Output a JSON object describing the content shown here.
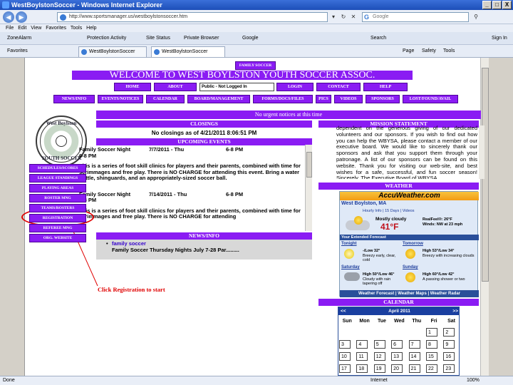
{
  "window": {
    "title": "WestBoylstonSoccer - Windows Internet Explorer",
    "min": "_",
    "max": "□",
    "close": "X"
  },
  "address": {
    "url": "http://www.sportsmanager.us/westboylstonsoccer.htm",
    "search_placeholder": "Google"
  },
  "menu": {
    "items": [
      "File",
      "Edit",
      "View",
      "Favorites",
      "Tools",
      "Help"
    ]
  },
  "toolbar": {
    "zone": "ZoneAlarm",
    "protection": "Protection Activity",
    "site_status": "Site Status",
    "private": "Private Browser",
    "google": "Google",
    "search": "Search",
    "signin": "Sign In"
  },
  "favbar": {
    "favorites": "Favorites",
    "tab1": "WestBoylstonSoccer",
    "tab2": "WestBoylstonSoccer",
    "page": "Page",
    "safety": "Safety",
    "tools": "Tools"
  },
  "site": {
    "family_soccer": "FAMILY SOCCER",
    "welcome": "WELCOME TO WEST BOYLSTON YOUTH SOCCER ASSOC.",
    "nav1": [
      "HOME",
      "ABOUT",
      "LOGIN",
      "CONTACT",
      "HELP"
    ],
    "login_status": "Public - Not Logged In",
    "nav2": [
      "NEWS/INFO",
      "EVENTS/NOTICES",
      "CALENDAR",
      "BOARD/MANAGEMENT",
      "FORMS/DOCS/FILES",
      "PICS",
      "VIDEOS",
      "SPONSORS",
      "LOST/FOUND/AVAIL"
    ],
    "logo_top": "West Boylston",
    "logo_bottom": "YOUTH SOCCER",
    "side": [
      "SCHEDULES/SCORES",
      "LEAGUE STANDINGS",
      "PLAYING AREAS",
      "ROSTER MNG",
      "TEAMS/ROSTERS",
      "REGISTRATION",
      "REFEREE MNG",
      "ORG. WEBSITE"
    ],
    "notice": "No urgent notices at this time",
    "closings_head": "CLOSINGS",
    "closings_text": "No closings as of 4/21/2011 8:06:51 PM",
    "upcoming_head": "UPCOMING EVENTS",
    "events": [
      {
        "title": "Family Soccer Night 6-8 PM",
        "date": "7/7/2011 - Thu",
        "time": "6-8 PM",
        "body": "This is a series of foot skill clinics for players and their parents, combined with time for scrimmages and free play. There is NO CHARGE for attending this event. Bring a water bottle, shinguards, and an appropriately-sized soccer ball."
      },
      {
        "title": "Family Soccer Night 6-8 PM",
        "date": "7/14/2011 - Thu",
        "time": "6-8 PM",
        "body": "This is a series of foot skill clinics for players and their parents, combined with time for scrimmages and free play. There is NO CHARGE for attending"
      }
    ],
    "news_head": "NEWS/INFO",
    "news_link": "family soccer",
    "news_sub": "Family Soccer Thursday Nights July 7-28 Par.........",
    "mission_head": "MISSION STATEMENT",
    "mission_text": "dependent on the generous giving of our dedicated volunteers and our sponsors. If you wish to find out how you can help the WBYSA, please contact a member of our executive board. We would like to sincerely thank our sponsors and ask that you support them through your patronage. A list of our sponsors can be found on this website. Thank you for visiting our web-site, and best wishes for a safe, successful, and fun soccer season! Sincerely, The Executive Board of WBYSA",
    "weather_head": "WEATHER",
    "calendar_head": "CALENDAR"
  },
  "weather": {
    "brand": "AccuWeather.com",
    "location": "West Boylston, MA",
    "links": "Hourly Info | 15 Days | Videos",
    "current": "Mostly cloudy",
    "temp": "41°F",
    "realfeel": "RealFeel®: 26°F",
    "winds": "Winds: NW at 23 mph",
    "extended": "Your Extended Forecast",
    "tonight": "Tonight",
    "tonight_temp": "-/Low 32°",
    "tonight_desc": "Breezy early, clear, cold",
    "tomorrow": "Tomorrow",
    "tomorrow_temp": "High 53°/Low 34°",
    "tomorrow_desc": "Breezy with increasing clouds",
    "saturday": "Saturday",
    "saturday_temp": "High 50°/Low 46°",
    "saturday_desc": "Cloudy with rain tapering off",
    "sunday": "Sunday",
    "sunday_temp": "High 60°/Low 42°",
    "sunday_desc": "A passing shower or two",
    "footer": "Weather Forecast | Weather Maps | Weather Radar"
  },
  "calendar": {
    "prev": "<<",
    "month": "April 2011",
    "next": ">>",
    "days": [
      "Sun",
      "Mon",
      "Tue",
      "Wed",
      "Thu",
      "Fri",
      "Sat"
    ],
    "weeks": [
      [
        "",
        "",
        "",
        "",
        "",
        "1",
        "2"
      ],
      [
        "3",
        "4",
        "5",
        "6",
        "7",
        "8",
        "9"
      ],
      [
        "10",
        "11",
        "12",
        "13",
        "14",
        "15",
        "16"
      ],
      [
        "17",
        "18",
        "19",
        "20",
        "21",
        "22",
        "23"
      ]
    ]
  },
  "annotation": {
    "text": "Click Registration to start",
    "color": "#e00000"
  },
  "status": {
    "left": "Done",
    "zone": "Internet",
    "zoom": "100%"
  },
  "colors": {
    "accent": "#8a1cf3",
    "calendar": "#1a3fa0"
  }
}
